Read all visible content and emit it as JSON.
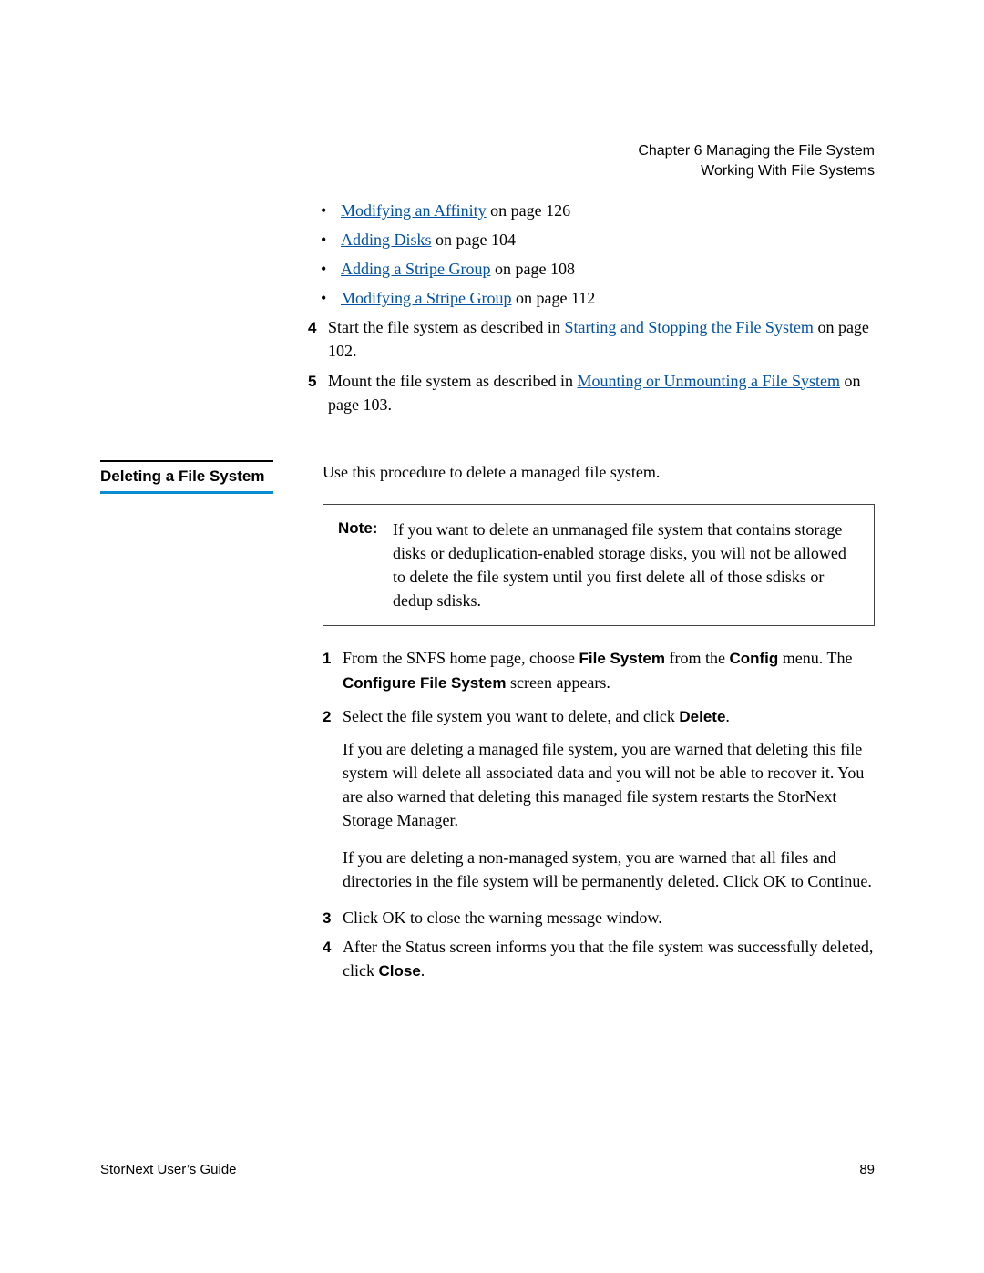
{
  "header": {
    "chapter": "Chapter 6  Managing the File System",
    "section": "Working With File Systems"
  },
  "bullets": [
    {
      "link": "Modifying an Affinity",
      "suffix": " on page  126"
    },
    {
      "link": "Adding Disks",
      "suffix": " on page  104"
    },
    {
      "link": "Adding a Stripe Group",
      "suffix": " on page  108"
    },
    {
      "link": "Modifying a Stripe Group",
      "suffix": " on page  112"
    }
  ],
  "step4": {
    "num": "4",
    "pre": "Start the file system as described in ",
    "link": "Starting and Stopping the File System",
    "suffix": " on page  102."
  },
  "step5": {
    "num": "5",
    "pre": "Mount the file system as described in ",
    "link": "Mounting or Unmounting a File System",
    "suffix": " on page  103."
  },
  "section": {
    "title": "Deleting a File System",
    "intro": "Use this procedure to delete a managed file system."
  },
  "note": {
    "label": "Note:",
    "text": "If you want to delete an unmanaged file system that contains storage disks or deduplication-enabled storage disks, you will not be allowed to delete the file system until you first delete all of those sdisks or dedup sdisks."
  },
  "steps": {
    "s1": {
      "num": "1",
      "t1": "From the SNFS home page, choose ",
      "b1": "File System",
      "t2": " from the ",
      "b2": "Config",
      "t3": " menu. The ",
      "b3": "Configure File System",
      "t4": " screen appears."
    },
    "s2": {
      "num": "2",
      "t1": "Select the file system you want to delete, and click ",
      "b1": "Delete",
      "t2": "."
    },
    "s2p1": "If you are deleting a managed file system, you are warned that deleting this file system will delete all associated data and you will not be able to recover it. You are also warned that deleting this managed file system restarts the StorNext Storage Manager.",
    "s2p2": "If you are deleting a non-managed system, you are warned that all files and directories in the file system will be permanently deleted. Click OK to Continue.",
    "s3": {
      "num": "3",
      "text": "Click OK to close the warning message window."
    },
    "s4": {
      "num": "4",
      "t1": "After the Status screen informs you that the file system was successfully deleted, click ",
      "b1": "Close",
      "t2": "."
    }
  },
  "footer": {
    "left": "StorNext User’s Guide",
    "right": "89"
  }
}
